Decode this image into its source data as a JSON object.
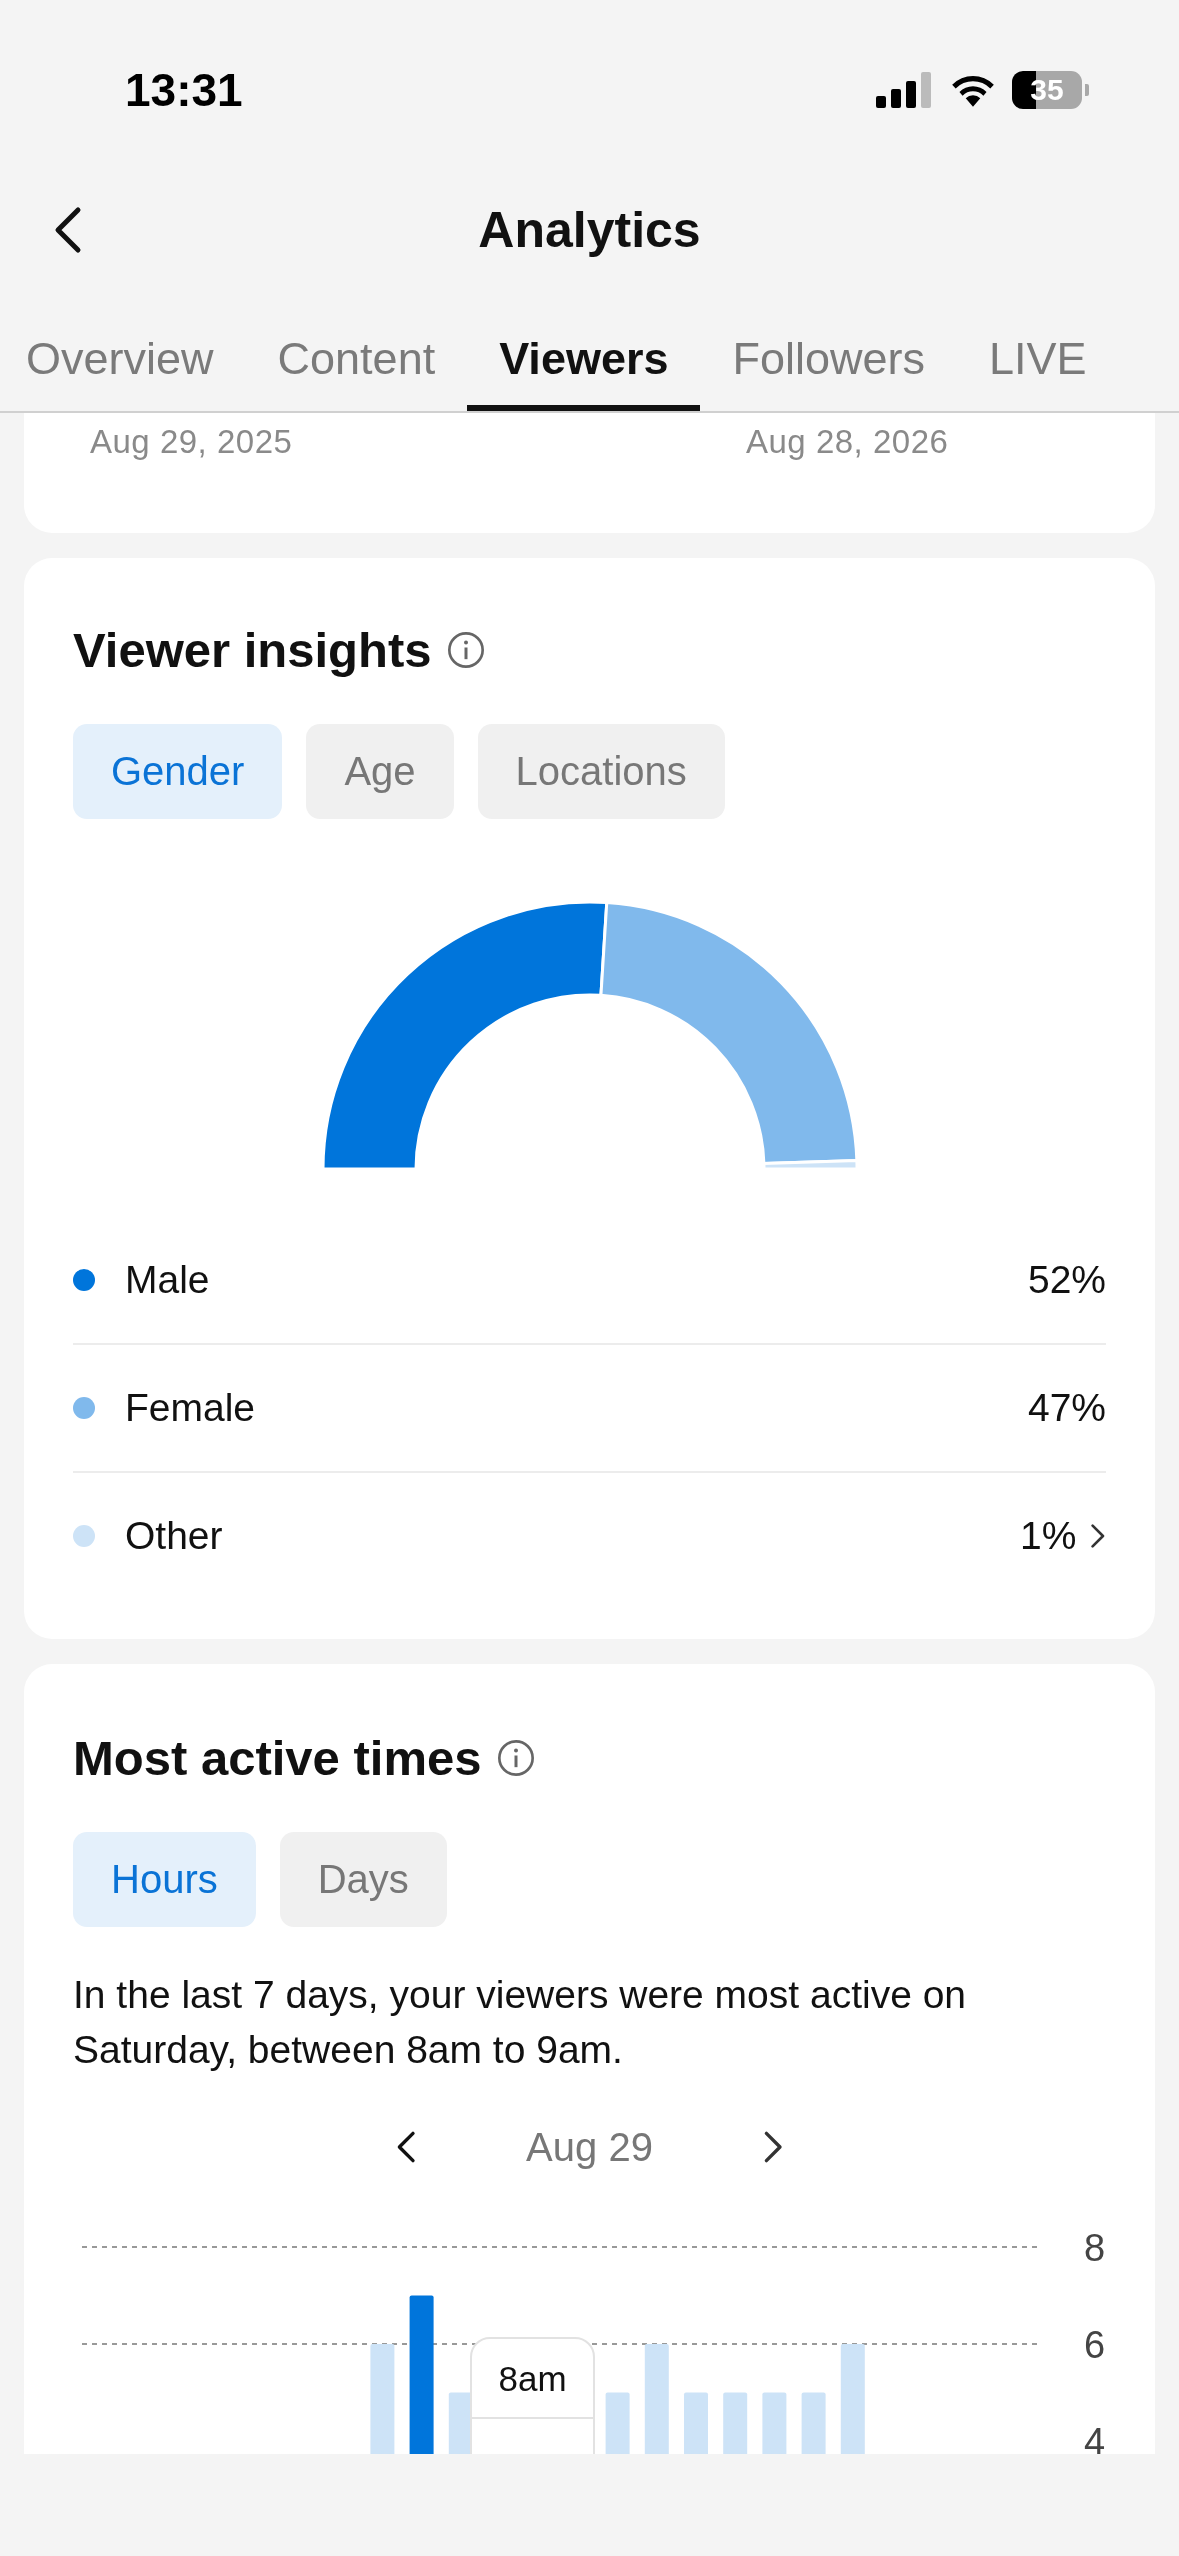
{
  "status_bar": {
    "time": "13:31",
    "battery": "35"
  },
  "header": {
    "title": "Analytics"
  },
  "tabs": [
    {
      "label": "Overview",
      "selected": false
    },
    {
      "label": "Content",
      "selected": false
    },
    {
      "label": "Viewers",
      "selected": true
    },
    {
      "label": "Followers",
      "selected": false
    },
    {
      "label": "LIVE",
      "selected": false
    }
  ],
  "date_range": {
    "start": "Aug 29, 2025",
    "end": "Aug 28, 2026"
  },
  "viewer_insights": {
    "title": "Viewer insights",
    "filters": [
      {
        "label": "Gender",
        "selected": true
      },
      {
        "label": "Age",
        "selected": false
      },
      {
        "label": "Locations",
        "selected": false
      }
    ],
    "chart_data": {
      "type": "donut",
      "categories": [
        "Male",
        "Female",
        "Other"
      ],
      "values": [
        52,
        47,
        1
      ]
    },
    "legend": [
      {
        "value": "52%",
        "color": "#0075db",
        "expandable": false
      },
      {
        "value": "47%",
        "color": "#80b9ec",
        "expandable": false
      },
      {
        "value": "1%",
        "color": "#cde3f7",
        "expandable": true
      }
    ]
  },
  "most_active_times": {
    "title": "Most active times",
    "filters": [
      {
        "label": "Hours",
        "selected": true
      },
      {
        "label": "Days",
        "selected": false
      }
    ],
    "summary": "In the last 7 days, your viewers were most active on Saturday, between 8am to 9am.",
    "date": "Aug 29",
    "tooltip": "8am",
    "chart_data": {
      "type": "bar",
      "yticks": [
        4,
        6,
        8
      ],
      "ylim": [
        0,
        8
      ],
      "values": [
        0,
        0,
        0,
        0,
        0,
        0,
        0,
        6,
        7,
        5,
        null,
        null,
        null,
        5,
        6,
        5,
        5,
        5,
        5,
        6,
        0,
        0,
        0,
        0
      ]
    }
  }
}
